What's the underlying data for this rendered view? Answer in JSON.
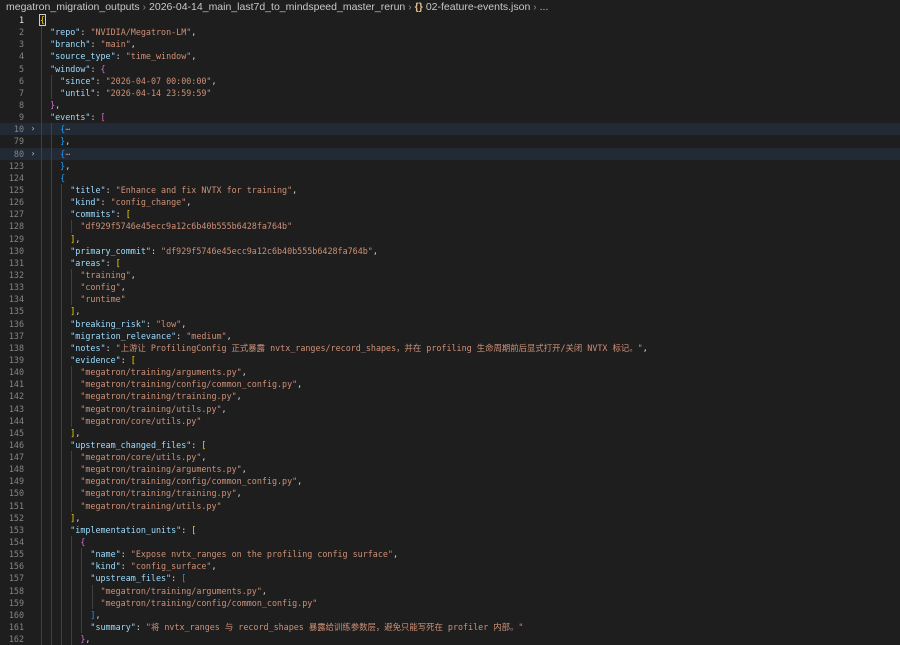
{
  "breadcrumb": {
    "items": [
      "megatron_migration_outputs",
      "2026-04-14_main_last7d_to_mindspeed_master_rerun",
      "02-feature-events.json",
      "..."
    ]
  },
  "colors": {
    "key": "#9cdcfe",
    "string": "#ce9178",
    "bracket_level1": "#ffd700",
    "bracket_level2": "#da70d6",
    "bracket_level3": "#179fff"
  },
  "lines": [
    {
      "n": "1",
      "t": [
        [
          "{",
          "b1"
        ]
      ],
      "active": true,
      "cursor": true
    },
    {
      "n": "2",
      "t": [
        [
          "  ",
          ""
        ],
        [
          "\"repo\"",
          "k"
        ],
        [
          ": ",
          "p"
        ],
        [
          "\"NVIDIA/Megatron-LM\"",
          "s"
        ],
        [
          ",",
          "p"
        ]
      ]
    },
    {
      "n": "3",
      "t": [
        [
          "  ",
          ""
        ],
        [
          "\"branch\"",
          "k"
        ],
        [
          ": ",
          "p"
        ],
        [
          "\"main\"",
          "s"
        ],
        [
          ",",
          "p"
        ]
      ]
    },
    {
      "n": "4",
      "t": [
        [
          "  ",
          ""
        ],
        [
          "\"source_type\"",
          "k"
        ],
        [
          ": ",
          "p"
        ],
        [
          "\"time_window\"",
          "s"
        ],
        [
          ",",
          "p"
        ]
      ]
    },
    {
      "n": "5",
      "t": [
        [
          "  ",
          ""
        ],
        [
          "\"window\"",
          "k"
        ],
        [
          ": ",
          "p"
        ],
        [
          "{",
          "b2"
        ]
      ]
    },
    {
      "n": "6",
      "t": [
        [
          "    ",
          ""
        ],
        [
          "\"since\"",
          "k"
        ],
        [
          ": ",
          "p"
        ],
        [
          "\"2026-04-07 00:00:00\"",
          "s"
        ],
        [
          ",",
          "p"
        ]
      ]
    },
    {
      "n": "7",
      "t": [
        [
          "    ",
          ""
        ],
        [
          "\"until\"",
          "k"
        ],
        [
          ": ",
          "p"
        ],
        [
          "\"2026-04-14 23:59:59\"",
          "s"
        ]
      ]
    },
    {
      "n": "8",
      "t": [
        [
          "  ",
          ""
        ],
        [
          "}",
          "b2"
        ],
        [
          ",",
          "p"
        ]
      ]
    },
    {
      "n": "9",
      "t": [
        [
          "  ",
          ""
        ],
        [
          "\"events\"",
          "k"
        ],
        [
          ": ",
          "p"
        ],
        [
          "[",
          "b2"
        ]
      ]
    },
    {
      "n": "10",
      "t": [
        [
          "    ",
          ""
        ],
        [
          "{",
          "b3"
        ],
        [
          "⋯",
          "fold-dots"
        ]
      ],
      "fold": "›",
      "hl": "strong"
    },
    {
      "n": "79",
      "t": [
        [
          "    ",
          ""
        ],
        [
          "}",
          "b3"
        ],
        [
          ",",
          "p"
        ]
      ]
    },
    {
      "n": "80",
      "t": [
        [
          "    ",
          ""
        ],
        [
          "{",
          "b3"
        ],
        [
          "⋯",
          "fold-dots"
        ]
      ],
      "fold": "›",
      "hl": "strong"
    },
    {
      "n": "123",
      "t": [
        [
          "    ",
          ""
        ],
        [
          "}",
          "b3"
        ],
        [
          ",",
          "p"
        ]
      ]
    },
    {
      "n": "124",
      "t": [
        [
          "    ",
          ""
        ],
        [
          "{",
          "b3"
        ]
      ]
    },
    {
      "n": "125",
      "t": [
        [
          "      ",
          ""
        ],
        [
          "\"title\"",
          "k"
        ],
        [
          ": ",
          "p"
        ],
        [
          "\"Enhance and fix NVTX for training\"",
          "s"
        ],
        [
          ",",
          "p"
        ]
      ]
    },
    {
      "n": "126",
      "t": [
        [
          "      ",
          ""
        ],
        [
          "\"kind\"",
          "k"
        ],
        [
          ": ",
          "p"
        ],
        [
          "\"config_change\"",
          "s"
        ],
        [
          ",",
          "p"
        ]
      ]
    },
    {
      "n": "127",
      "t": [
        [
          "      ",
          ""
        ],
        [
          "\"commits\"",
          "k"
        ],
        [
          ": ",
          "p"
        ],
        [
          "[",
          "b1"
        ]
      ]
    },
    {
      "n": "128",
      "t": [
        [
          "        ",
          ""
        ],
        [
          "\"df929f5746e45ecc9a12c6b40b555b6428fa764b\"",
          "s"
        ]
      ]
    },
    {
      "n": "129",
      "t": [
        [
          "      ",
          ""
        ],
        [
          "]",
          "b1"
        ],
        [
          ",",
          "p"
        ]
      ]
    },
    {
      "n": "130",
      "t": [
        [
          "      ",
          ""
        ],
        [
          "\"primary_commit\"",
          "k"
        ],
        [
          ": ",
          "p"
        ],
        [
          "\"df929f5746e45ecc9a12c6b40b555b6428fa764b\"",
          "s"
        ],
        [
          ",",
          "p"
        ]
      ]
    },
    {
      "n": "131",
      "t": [
        [
          "      ",
          ""
        ],
        [
          "\"areas\"",
          "k"
        ],
        [
          ": ",
          "p"
        ],
        [
          "[",
          "b1"
        ]
      ]
    },
    {
      "n": "132",
      "t": [
        [
          "        ",
          ""
        ],
        [
          "\"training\"",
          "s"
        ],
        [
          ",",
          "p"
        ]
      ]
    },
    {
      "n": "133",
      "t": [
        [
          "        ",
          ""
        ],
        [
          "\"config\"",
          "s"
        ],
        [
          ",",
          "p"
        ]
      ]
    },
    {
      "n": "134",
      "t": [
        [
          "        ",
          ""
        ],
        [
          "\"runtime\"",
          "s"
        ]
      ]
    },
    {
      "n": "135",
      "t": [
        [
          "      ",
          ""
        ],
        [
          "]",
          "b1"
        ],
        [
          ",",
          "p"
        ]
      ]
    },
    {
      "n": "136",
      "t": [
        [
          "      ",
          ""
        ],
        [
          "\"breaking_risk\"",
          "k"
        ],
        [
          ": ",
          "p"
        ],
        [
          "\"low\"",
          "s"
        ],
        [
          ",",
          "p"
        ]
      ]
    },
    {
      "n": "137",
      "t": [
        [
          "      ",
          ""
        ],
        [
          "\"migration_relevance\"",
          "k"
        ],
        [
          ": ",
          "p"
        ],
        [
          "\"medium\"",
          "s"
        ],
        [
          ",",
          "p"
        ]
      ]
    },
    {
      "n": "138",
      "t": [
        [
          "      ",
          ""
        ],
        [
          "\"notes\"",
          "k"
        ],
        [
          ": ",
          "p"
        ],
        [
          "\"上游让 ProfilingConfig 正式暴露 nvtx_ranges/record_shapes，并在 profiling 生命周期前后显式打开/关闭 NVTX 标记。\"",
          "s"
        ],
        [
          ",",
          "p"
        ]
      ]
    },
    {
      "n": "139",
      "t": [
        [
          "      ",
          ""
        ],
        [
          "\"evidence\"",
          "k"
        ],
        [
          ": ",
          "p"
        ],
        [
          "[",
          "b1"
        ]
      ]
    },
    {
      "n": "140",
      "t": [
        [
          "        ",
          ""
        ],
        [
          "\"megatron/training/arguments.py\"",
          "s"
        ],
        [
          ",",
          "p"
        ]
      ]
    },
    {
      "n": "141",
      "t": [
        [
          "        ",
          ""
        ],
        [
          "\"megatron/training/config/common_config.py\"",
          "s"
        ],
        [
          ",",
          "p"
        ]
      ]
    },
    {
      "n": "142",
      "t": [
        [
          "        ",
          ""
        ],
        [
          "\"megatron/training/training.py\"",
          "s"
        ],
        [
          ",",
          "p"
        ]
      ]
    },
    {
      "n": "143",
      "t": [
        [
          "        ",
          ""
        ],
        [
          "\"megatron/training/utils.py\"",
          "s"
        ],
        [
          ",",
          "p"
        ]
      ]
    },
    {
      "n": "144",
      "t": [
        [
          "        ",
          ""
        ],
        [
          "\"megatron/core/utils.py\"",
          "s"
        ]
      ]
    },
    {
      "n": "145",
      "t": [
        [
          "      ",
          ""
        ],
        [
          "]",
          "b1"
        ],
        [
          ",",
          "p"
        ]
      ]
    },
    {
      "n": "146",
      "t": [
        [
          "      ",
          ""
        ],
        [
          "\"upstream_changed_files\"",
          "k"
        ],
        [
          ": ",
          "p"
        ],
        [
          "[",
          "b1"
        ]
      ]
    },
    {
      "n": "147",
      "t": [
        [
          "        ",
          ""
        ],
        [
          "\"megatron/core/utils.py\"",
          "s"
        ],
        [
          ",",
          "p"
        ]
      ]
    },
    {
      "n": "148",
      "t": [
        [
          "        ",
          ""
        ],
        [
          "\"megatron/training/arguments.py\"",
          "s"
        ],
        [
          ",",
          "p"
        ]
      ]
    },
    {
      "n": "149",
      "t": [
        [
          "        ",
          ""
        ],
        [
          "\"megatron/training/config/common_config.py\"",
          "s"
        ],
        [
          ",",
          "p"
        ]
      ]
    },
    {
      "n": "150",
      "t": [
        [
          "        ",
          ""
        ],
        [
          "\"megatron/training/training.py\"",
          "s"
        ],
        [
          ",",
          "p"
        ]
      ]
    },
    {
      "n": "151",
      "t": [
        [
          "        ",
          ""
        ],
        [
          "\"megatron/training/utils.py\"",
          "s"
        ]
      ]
    },
    {
      "n": "152",
      "t": [
        [
          "      ",
          ""
        ],
        [
          "]",
          "b1"
        ],
        [
          ",",
          "p"
        ]
      ]
    },
    {
      "n": "153",
      "t": [
        [
          "      ",
          ""
        ],
        [
          "\"implementation_units\"",
          "k"
        ],
        [
          ": ",
          "p"
        ],
        [
          "[",
          "b1"
        ]
      ]
    },
    {
      "n": "154",
      "t": [
        [
          "        ",
          ""
        ],
        [
          "{",
          "b2"
        ]
      ]
    },
    {
      "n": "155",
      "t": [
        [
          "          ",
          ""
        ],
        [
          "\"name\"",
          "k"
        ],
        [
          ": ",
          "p"
        ],
        [
          "\"Expose nvtx_ranges on the profiling config surface\"",
          "s"
        ],
        [
          ",",
          "p"
        ]
      ]
    },
    {
      "n": "156",
      "t": [
        [
          "          ",
          ""
        ],
        [
          "\"kind\"",
          "k"
        ],
        [
          ": ",
          "p"
        ],
        [
          "\"config_surface\"",
          "s"
        ],
        [
          ",",
          "p"
        ]
      ]
    },
    {
      "n": "157",
      "t": [
        [
          "          ",
          ""
        ],
        [
          "\"upstream_files\"",
          "k"
        ],
        [
          ": ",
          "p"
        ],
        [
          "[",
          "b3"
        ]
      ]
    },
    {
      "n": "158",
      "t": [
        [
          "            ",
          ""
        ],
        [
          "\"megatron/training/arguments.py\"",
          "s"
        ],
        [
          ",",
          "p"
        ]
      ]
    },
    {
      "n": "159",
      "t": [
        [
          "            ",
          ""
        ],
        [
          "\"megatron/training/config/common_config.py\"",
          "s"
        ]
      ]
    },
    {
      "n": "160",
      "t": [
        [
          "          ",
          ""
        ],
        [
          "]",
          "b3"
        ],
        [
          ",",
          "p"
        ]
      ]
    },
    {
      "n": "161",
      "t": [
        [
          "          ",
          ""
        ],
        [
          "\"summary\"",
          "k"
        ],
        [
          ": ",
          "p"
        ],
        [
          "\"将 nvtx_ranges 与 record_shapes 暴露给训练参数层，避免只能写死在 profiler 内部。\"",
          "s"
        ]
      ]
    },
    {
      "n": "162",
      "t": [
        [
          "        ",
          ""
        ],
        [
          "}",
          "b2"
        ],
        [
          ",",
          "p"
        ]
      ]
    }
  ]
}
